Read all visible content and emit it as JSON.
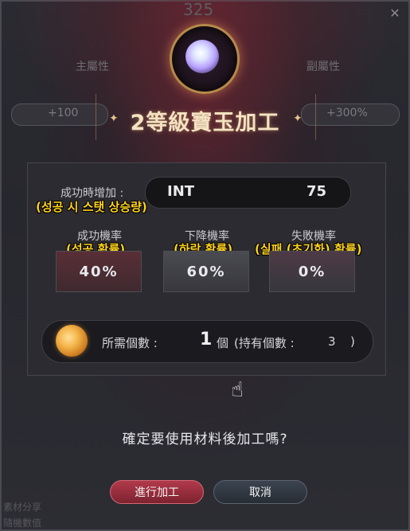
{
  "background": {
    "top_value": "325",
    "left_label": "主屬性",
    "right_label": "副屬性",
    "left_pill": "+100",
    "right_pill": "+300%",
    "bottom_left_1": "素材分享",
    "bottom_left_2": "隨機數值"
  },
  "dialog": {
    "close_icon": "close-icon",
    "gem_icon": "gem-icon",
    "title": "2等級寶玉加工",
    "success_increase_label": "成功時增加 :",
    "success_increase_annotation": "(성공 시 스탯 상승량)",
    "stat": {
      "name": "INT",
      "value": "75"
    },
    "rates": [
      {
        "title": "成功機率",
        "annotation": "(성공 확률)",
        "value": "40%"
      },
      {
        "title": "下降機率",
        "annotation": "(하락 확률)",
        "value": "60%"
      },
      {
        "title": "失敗機率",
        "annotation": "(실패 (초기화) 확률)",
        "value": "0%"
      }
    ],
    "material": {
      "icon": "material-icon",
      "label": "所需個數 :",
      "count": "1",
      "unit": "個",
      "owned_label": "(持有個數 :",
      "owned_value": "3",
      "owned_close": ")"
    },
    "question": "確定要使用材料後加工嗎?",
    "buttons": {
      "confirm": "進行加工",
      "cancel": "取消"
    }
  },
  "colors": {
    "accent_red": "#b13a4a",
    "annotation_yellow": "#ffd21c",
    "title_gold": "#f3e3c2"
  }
}
